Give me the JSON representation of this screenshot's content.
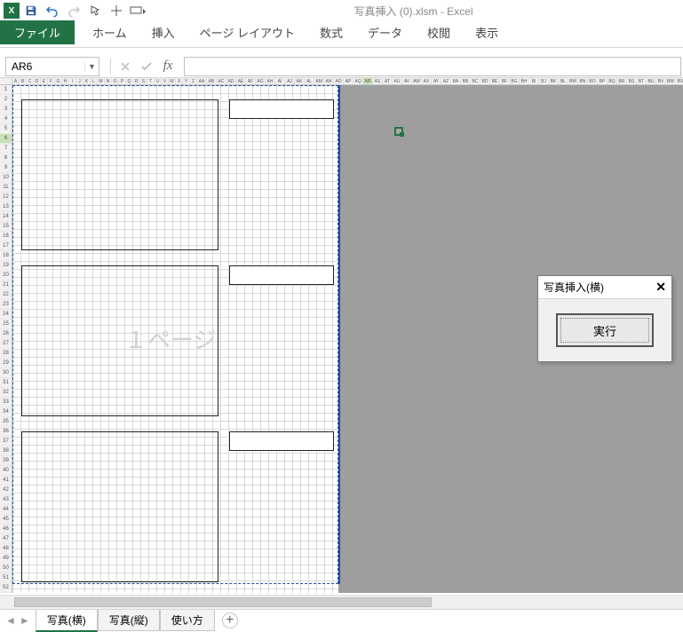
{
  "app": {
    "title": "写真挿入 (0).xlsm - Excel",
    "name_box": "AR6"
  },
  "ribbon": {
    "file": "ファイル",
    "tabs": [
      "ホーム",
      "挿入",
      "ページ レイアウト",
      "数式",
      "データ",
      "校閲",
      "表示"
    ]
  },
  "columns_narrow": [
    "A",
    "B",
    "C",
    "D",
    "E",
    "F",
    "G",
    "H",
    "I",
    "J",
    "K",
    "L",
    "M",
    "N",
    "O",
    "P",
    "Q",
    "R",
    "S",
    "T",
    "U",
    "V",
    "W",
    "X",
    "Y",
    "Z",
    "AA",
    "AB",
    "AC",
    "AD",
    "AE",
    "AF",
    "AG",
    "AH",
    "AI",
    "AJ",
    "AK",
    "AL",
    "AM",
    "AN",
    "AO",
    "AP",
    "AQ",
    "AR",
    "AS",
    "AT",
    "AU",
    "AV",
    "AW",
    "AX",
    "AY",
    "AZ",
    "BA",
    "BB",
    "BC",
    "BD",
    "BE",
    "BF",
    "BG",
    "BH",
    "BI",
    "BJ",
    "BK",
    "BL",
    "BM",
    "BN",
    "BO",
    "BP",
    "BQ",
    "BR",
    "BS",
    "BT",
    "BU",
    "BV",
    "BW",
    "BX"
  ],
  "selected_col_index": 43,
  "rows_count": 52,
  "selected_row": 6,
  "watermark": "１ページ",
  "sheet_tabs": [
    "写真(横)",
    "写真(縦)",
    "使い方"
  ],
  "active_sheet": 0,
  "dialog": {
    "title": "写真挿入(横)",
    "button": "実行"
  }
}
